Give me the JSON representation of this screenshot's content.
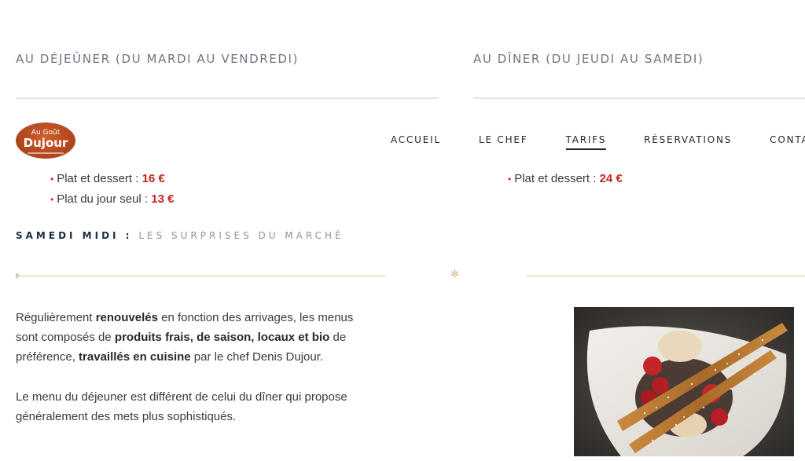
{
  "columns": {
    "lunch": {
      "title": "AU DÉJEÛNER (DU MARDI AU VENDREDI)",
      "items": [
        {
          "label": "Plat et dessert :",
          "price": "16 €"
        },
        {
          "label": "Plat du jour seul :",
          "price": "13 €"
        }
      ]
    },
    "dinner": {
      "title": "AU DÎNER (DU JEUDI AU SAMEDI)",
      "items": [
        {
          "label": "Plat et dessert :",
          "price": "24 €"
        }
      ]
    }
  },
  "logo": {
    "line1": "Au Goût",
    "line2": "Dujour"
  },
  "nav": {
    "items": [
      "ACCUEIL",
      "LE CHEF",
      "TARIFS",
      "RÉSERVATIONS",
      "CONTACT"
    ],
    "active": "TARIFS"
  },
  "samedi": {
    "label": "SAMEDI MIDI :",
    "value": "LES SURPRISES DU MARCHÉ"
  },
  "divider": {
    "ornament": "✻"
  },
  "description": {
    "p1": {
      "a": "Régulièrement ",
      "b": "renouvelés",
      "c": " en fonction des arrivages, les menus sont composés de ",
      "d": "produits frais, de saison, locaux et bio",
      "e": " de préférence, ",
      "f": "travaillés en cuisine",
      "g": " par le chef Denis Dujour."
    },
    "p2": "Le menu du déjeuner est différent de celui du dîner qui propose généralement des mets plus sophistiqués."
  },
  "colors": {
    "accent_price": "#c8241c",
    "gold": "#dcc9a6",
    "navy": "#1f2d4a"
  }
}
